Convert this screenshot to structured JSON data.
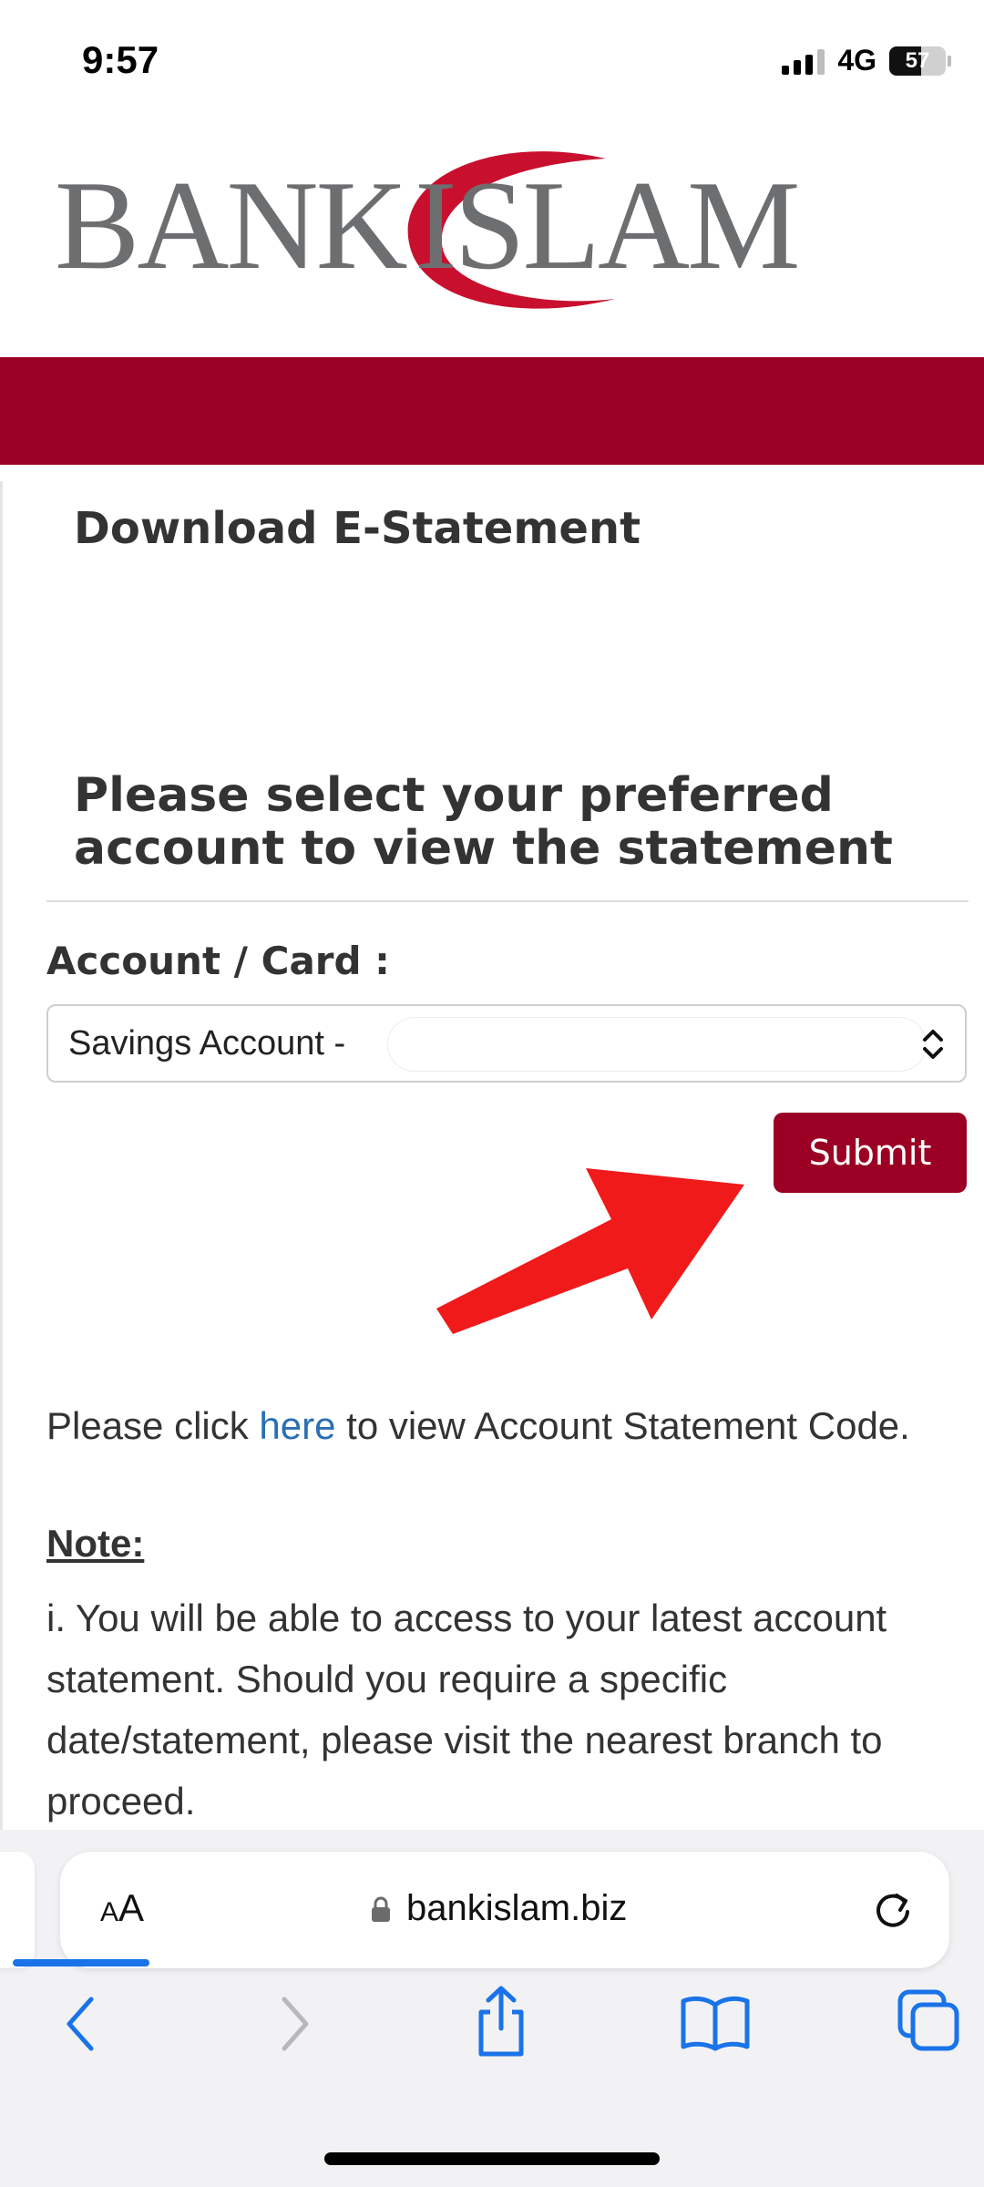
{
  "status_bar": {
    "time": "9:57",
    "network": "4G",
    "battery": "57",
    "battery_level": 0.57
  },
  "brand": {
    "logo_left": "BANK",
    "logo_right": "ISLAM",
    "band_color": "#9b0024",
    "arc_color": "#c8102e"
  },
  "page": {
    "title": "Download E-Statement",
    "prompt": "Please select your preferred account to view the statement"
  },
  "form": {
    "account_label": "Account / Card :",
    "account_selected": "Savings Account -",
    "submit_label": "Submit"
  },
  "info": {
    "prefix": "Please click ",
    "link_text": "here",
    "suffix": " to view Account Statement Code.",
    "note_heading": "Note:",
    "note_text": "i. You will be able to access to your latest account statement. Should you require a specific date/statement, please visit the nearest branch to proceed."
  },
  "browser": {
    "aa_small": "A",
    "aa_large": "A",
    "url": "bankislam.biz",
    "icons": [
      "back-icon",
      "forward-icon",
      "share-icon",
      "bookmarks-icon",
      "tabs-icon",
      "reload-icon",
      "lock-icon"
    ]
  },
  "annotation": {
    "arrow_color": "#f01a1a"
  }
}
